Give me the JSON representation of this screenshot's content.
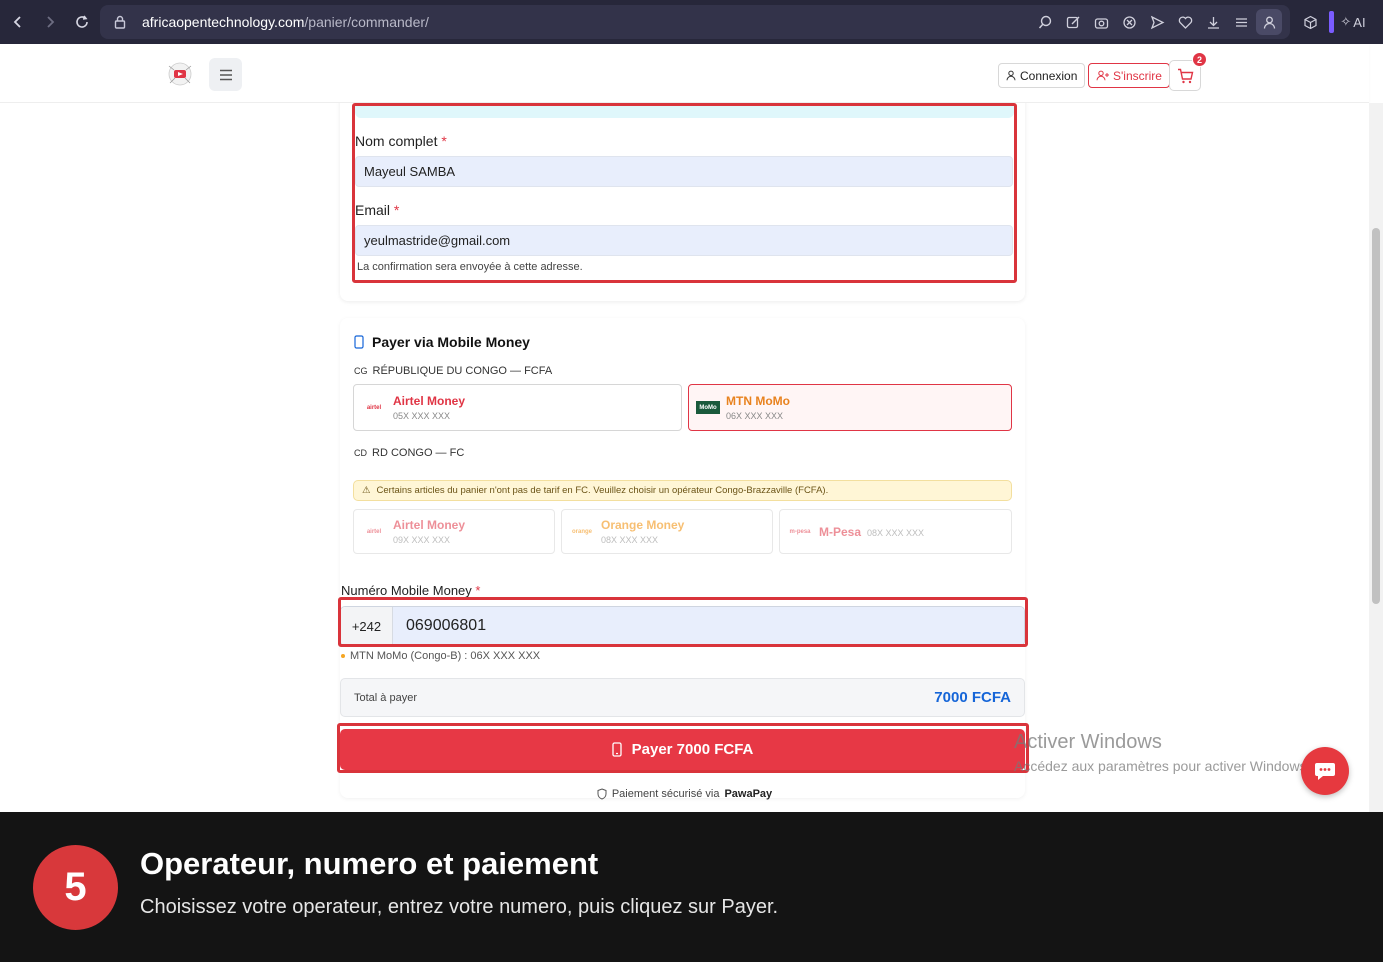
{
  "browser": {
    "url_domain": "africaopentechnology.com",
    "url_path": "/panier/commander/",
    "ai_label": "AI"
  },
  "header": {
    "login_label": "Connexion",
    "signup_label": "S'inscrire",
    "cart_count": "2"
  },
  "form": {
    "name_label": "Nom complet",
    "name_value": "Mayeul SAMBA",
    "email_label": "Email",
    "email_value": "yeulmastride@gmail.com",
    "email_hint": "La confirmation sera envoyée à cette adresse.",
    "required_mark": "*"
  },
  "payment": {
    "title": "Payer via Mobile Money",
    "country1": {
      "code": "CG",
      "name": "RÉPUBLIQUE DU CONGO — FCFA"
    },
    "country2": {
      "code": "CD",
      "name": "RD CONGO — FC"
    },
    "operators_cg": [
      {
        "name": "Airtel Money",
        "format": "05X XXX XXX",
        "logo_text": "airtel"
      },
      {
        "name": "MTN MoMo",
        "format": "06X XXX XXX",
        "logo_text": "MoMo",
        "selected": true
      }
    ],
    "warning": "Certains articles du panier n'ont pas de tarif en FC. Veuillez choisir un opérateur Congo-Brazzaville (FCFA).",
    "operators_cd": [
      {
        "name": "Airtel Money",
        "format": "09X XXX XXX",
        "logo_text": "airtel"
      },
      {
        "name": "Orange Money",
        "format": "08X XXX XXX",
        "logo_text": "orange"
      },
      {
        "name": "M-Pesa",
        "format": "08X XXX XXX",
        "logo_text": "m-pesa"
      }
    ],
    "phone_label": "Numéro Mobile Money",
    "phone_prefix": "+242",
    "phone_value": "069006801",
    "phone_hint": "MTN MoMo (Congo-B) : 06X XXX XXX",
    "total_label": "Total à payer",
    "total_value": "7000 FCFA",
    "pay_button": "Payer 7000 FCFA",
    "secure_prefix": "Paiement sécurisé via",
    "secure_provider": "PawaPay"
  },
  "watermark": {
    "line1": "Activer Windows",
    "line2": "Accédez aux paramètres pour activer Windows."
  },
  "banner": {
    "step": "5",
    "title": "Operateur, numero et paiement",
    "subtitle": "Choisissez votre operateur, entrez votre numero, puis cliquez sur Payer."
  },
  "colors": {
    "brand_red": "#e73845",
    "total_blue": "#1565d8",
    "highlight_red": "#d9343b"
  }
}
